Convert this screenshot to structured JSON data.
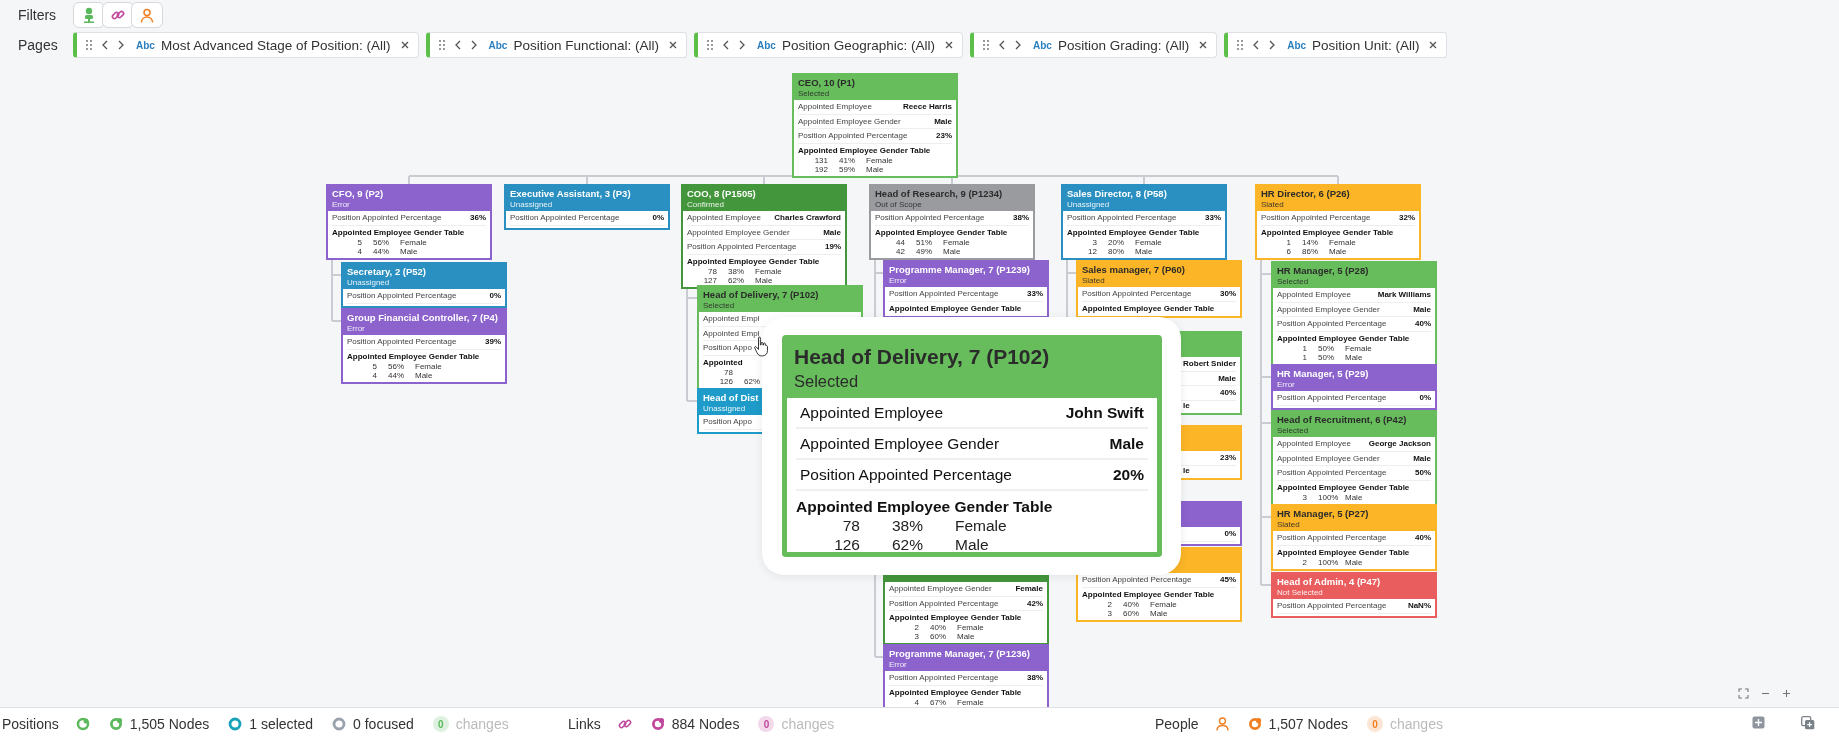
{
  "filters": {
    "label": "Filters",
    "chips": [
      {
        "kind": "position",
        "color": "#5cb85c"
      },
      {
        "kind": "link",
        "color": "#c0479b"
      },
      {
        "kind": "person",
        "color": "#f07f22"
      }
    ]
  },
  "pages": {
    "label": "Pages",
    "chips": [
      {
        "type_label": "Abc",
        "text": "Most Advanced Stage of Position: (All)"
      },
      {
        "type_label": "Abc",
        "text": "Position Functional: (All)"
      },
      {
        "type_label": "Abc",
        "text": "Position Geographic: (All)"
      },
      {
        "type_label": "Abc",
        "text": "Position Grading: (All)"
      },
      {
        "type_label": "Abc",
        "text": "Position Unit: (All)"
      }
    ]
  },
  "org": [
    {
      "title": "CEO, 10 (P1)",
      "status": "Selected",
      "color": "#67bd5c",
      "rows": [
        {
          "kind": "pair",
          "label": "Appointed Employee",
          "value": "Reece Harris"
        },
        {
          "kind": "pair",
          "label": "Appointed Employee Gender",
          "value": "Male"
        },
        {
          "kind": "pair",
          "label": "Position Appointed Percentage",
          "value": "23%"
        },
        {
          "kind": "heading",
          "text": "Appointed Employee Gender Table"
        },
        {
          "kind": "data",
          "cells": [
            "131",
            "41%",
            "Female"
          ]
        },
        {
          "kind": "data",
          "cells": [
            "192",
            "59%",
            "Male"
          ]
        }
      ],
      "children": [
        {
          "title": "CFO, 9 (P2)",
          "status": "Error",
          "color": "#8c62cc",
          "rows": [
            {
              "kind": "pair",
              "label": "Position Appointed Percentage",
              "value": "36%"
            },
            {
              "kind": "heading",
              "text": "Appointed Employee Gender Table"
            },
            {
              "kind": "data",
              "cells": [
                "5",
                "56%",
                "Female"
              ]
            },
            {
              "kind": "data",
              "cells": [
                "4",
                "44%",
                "Male"
              ]
            }
          ],
          "children": [
            {
              "title": "Secretary, 2 (P52)",
              "status": "Unassigned",
              "color": "#2a8fc1",
              "rows": [
                {
                  "kind": "pair",
                  "label": "Position Appointed Percentage",
                  "value": "0%"
                }
              ]
            },
            {
              "title": "Group Financial Controller, 7 (P4)",
              "status": "Error",
              "color": "#8c62cc",
              "rows": [
                {
                  "kind": "pair",
                  "label": "Position Appointed Percentage",
                  "value": "39%"
                },
                {
                  "kind": "heading",
                  "text": "Appointed Employee Gender Table"
                },
                {
                  "kind": "data",
                  "cells": [
                    "5",
                    "56%",
                    "Female"
                  ]
                },
                {
                  "kind": "data",
                  "cells": [
                    "4",
                    "44%",
                    "Male"
                  ]
                }
              ]
            }
          ]
        },
        {
          "title": "Executive Assistant, 3 (P3)",
          "status": "Unassigned",
          "color": "#2a8fc1",
          "rows": [
            {
              "kind": "pair",
              "label": "Position Appointed Percentage",
              "value": "0%"
            }
          ]
        },
        {
          "title": "COO, 8 (P1505)",
          "status": "Confirmed",
          "color": "#43963b",
          "rows": [
            {
              "kind": "pair",
              "label": "Appointed Employee",
              "value": "Charles Crawford"
            },
            {
              "kind": "pair",
              "label": "Appointed Employee Gender",
              "value": "Male"
            },
            {
              "kind": "pair",
              "label": "Position Appointed Percentage",
              "value": "19%"
            },
            {
              "kind": "heading",
              "text": "Appointed Employee Gender Table"
            },
            {
              "kind": "data",
              "cells": [
                "78",
                "38%",
                "Female"
              ]
            },
            {
              "kind": "data",
              "cells": [
                "127",
                "62%",
                "Male"
              ]
            }
          ],
          "children": [
            {
              "title": "Head of Delivery, 7 (P102)",
              "status": "Selected",
              "color": "#67bd5c",
              "rows": [
                {
                  "kind": "pair",
                  "label": "Appointed Empl"
                },
                {
                  "kind": "pair",
                  "label": "Appointed Empl"
                },
                {
                  "kind": "pair",
                  "label": "Position Appo"
                },
                {
                  "kind": "heading",
                  "text": "Appointed"
                },
                {
                  "kind": "data",
                  "cells": [
                    "78"
                  ]
                },
                {
                  "kind": "data",
                  "cells": [
                    "126",
                    "62%"
                  ]
                }
              ]
            },
            {
              "title": "Head of Dist",
              "status": "Unassigned",
              "color": "#1e9bc9",
              "rows": [
                {
                  "kind": "pair",
                  "label": "Position Appo"
                }
              ]
            }
          ]
        },
        {
          "title": "Head of Research, 9 (P1234)",
          "status": "Out of Scope",
          "color": "#9a9b9e",
          "rows": [
            {
              "kind": "pair",
              "label": "Position Appointed Percentage",
              "value": "38%"
            },
            {
              "kind": "heading",
              "text": "Appointed Employee Gender Table"
            },
            {
              "kind": "data",
              "cells": [
                "44",
                "51%",
                "Female"
              ]
            },
            {
              "kind": "data",
              "cells": [
                "42",
                "49%",
                "Male"
              ]
            }
          ],
          "children": [
            {
              "title": "Programme Manager, 7 (P1239)",
              "status": "Error",
              "color": "#8c62cc",
              "rows": [
                {
                  "kind": "pair",
                  "label": "Position Appointed Percentage",
                  "value": "33%"
                },
                {
                  "kind": "heading",
                  "text": "Appointed Employee Gender Table"
                }
              ]
            },
            {
              "color": "#43963b",
              "rows": [
                {
                  "kind": "pair",
                  "label": "Appointed Employee Gender",
                  "value": "Female"
                },
                {
                  "kind": "pair",
                  "label": "Position Appointed Percentage",
                  "value": "42%"
                },
                {
                  "kind": "heading",
                  "text": "Appointed Employee Gender Table"
                },
                {
                  "kind": "data",
                  "cells": [
                    "2",
                    "40%",
                    "Female"
                  ]
                },
                {
                  "kind": "data",
                  "cells": [
                    "3",
                    "60%",
                    "Male"
                  ]
                }
              ]
            },
            {
              "title": "Programme Manager, 7 (P1236)",
              "status": "Error",
              "color": "#8c62cc",
              "rows": [
                {
                  "kind": "pair",
                  "label": "Position Appointed Percentage",
                  "value": "38%"
                },
                {
                  "kind": "heading",
                  "text": "Appointed Employee Gender Table"
                },
                {
                  "kind": "data",
                  "cells": [
                    "4",
                    "67%",
                    "Female"
                  ]
                }
              ]
            }
          ]
        },
        {
          "title": "Sales Director, 8 (P58)",
          "status": "Unassigned",
          "color": "#2a8fc1",
          "rows": [
            {
              "kind": "pair",
              "label": "Position Appointed Percentage",
              "value": "33%"
            },
            {
              "kind": "heading",
              "text": "Appointed Employee Gender Table"
            },
            {
              "kind": "data",
              "cells": [
                "3",
                "20%",
                "Female"
              ]
            },
            {
              "kind": "data",
              "cells": [
                "12",
                "80%",
                "Male"
              ]
            }
          ],
          "children": [
            {
              "title": "Sales manager, 7 (P60)",
              "status": "Slated",
              "color": "#fbb526",
              "rows": [
                {
                  "kind": "pair",
                  "label": "Position Appointed Percentage",
                  "value": "30%"
                },
                {
                  "kind": "heading",
                  "text": "Appointed Employee Gender Table"
                }
              ]
            },
            {
              "color": "#67bd5c",
              "rows": [
                {
                  "kind": "pair",
                  "value": "Robert Snider"
                },
                {
                  "kind": "pair",
                  "value": "Male"
                },
                {
                  "kind": "pair",
                  "value": "40%"
                },
                {
                  "kind": "tail",
                  "text": "le"
                }
              ]
            },
            {
              "color": "#fbb526",
              "rows": [
                {
                  "kind": "pair",
                  "value": "23%"
                },
                {
                  "kind": "tail",
                  "text": "le"
                }
              ]
            },
            {
              "color": "#8c62cc",
              "rows": [
                {
                  "kind": "pair",
                  "value": "0%"
                }
              ]
            },
            {
              "color": "#fbb526",
              "rows": [
                {
                  "kind": "pair",
                  "label": "Position Appointed Percentage",
                  "value": "45%"
                },
                {
                  "kind": "heading",
                  "text": "Appointed Employee Gender Table"
                },
                {
                  "kind": "data",
                  "cells": [
                    "2",
                    "40%",
                    "Female"
                  ]
                },
                {
                  "kind": "data",
                  "cells": [
                    "3",
                    "60%",
                    "Male"
                  ]
                }
              ]
            }
          ]
        },
        {
          "title": "HR Director, 6 (P26)",
          "status": "Slated",
          "color": "#fbb526",
          "rows": [
            {
              "kind": "pair",
              "label": "Position Appointed Percentage",
              "value": "32%"
            },
            {
              "kind": "heading",
              "text": "Appointed Employee Gender Table"
            },
            {
              "kind": "data",
              "cells": [
                "1",
                "14%",
                "Female"
              ]
            },
            {
              "kind": "data",
              "cells": [
                "6",
                "86%",
                "Male"
              ]
            }
          ],
          "children": [
            {
              "title": "HR Manager, 5 (P28)",
              "status": "Selected",
              "color": "#67bd5c",
              "rows": [
                {
                  "kind": "pair",
                  "label": "Appointed Employee",
                  "value": "Mark Williams"
                },
                {
                  "kind": "pair",
                  "label": "Appointed Employee Gender",
                  "value": "Male"
                },
                {
                  "kind": "pair",
                  "label": "Position Appointed Percentage",
                  "value": "40%"
                },
                {
                  "kind": "heading",
                  "text": "Appointed Employee Gender Table"
                },
                {
                  "kind": "data",
                  "cells": [
                    "1",
                    "50%",
                    "Female"
                  ]
                },
                {
                  "kind": "data",
                  "cells": [
                    "1",
                    "50%",
                    "Male"
                  ]
                }
              ]
            },
            {
              "title": "HR Manager, 5 (P29)",
              "status": "Error",
              "color": "#8c62cc",
              "rows": [
                {
                  "kind": "pair",
                  "label": "Position Appointed Percentage",
                  "value": "0%"
                }
              ]
            },
            {
              "title": "Head of Recruitment, 6 (P42)",
              "status": "Selected",
              "color": "#67bd5c",
              "rows": [
                {
                  "kind": "pair",
                  "label": "Appointed Employee",
                  "value": "George Jackson"
                },
                {
                  "kind": "pair",
                  "label": "Appointed Employee Gender",
                  "value": "Male"
                },
                {
                  "kind": "pair",
                  "label": "Position Appointed Percentage",
                  "value": "50%"
                },
                {
                  "kind": "heading",
                  "text": "Appointed Employee Gender Table"
                },
                {
                  "kind": "data",
                  "cells": [
                    "3",
                    "100%",
                    "Male"
                  ]
                }
              ]
            },
            {
              "title": "HR Manager, 5 (P27)",
              "status": "Slated",
              "color": "#fbb526",
              "rows": [
                {
                  "kind": "pair",
                  "label": "Position Appointed Percentage",
                  "value": "40%"
                },
                {
                  "kind": "heading",
                  "text": "Appointed Employee Gender Table"
                },
                {
                  "kind": "data",
                  "cells": [
                    "2",
                    "100%",
                    "Male"
                  ]
                }
              ]
            },
            {
              "title": "Head of Admin, 4 (P47)",
              "status": "Not Selected",
              "color": "#e95d5f",
              "rows": [
                {
                  "kind": "pair",
                  "label": "Position Appointed Percentage",
                  "value": "NaN%"
                }
              ]
            }
          ]
        }
      ]
    }
  ],
  "popup": {
    "title": "Head of Delivery, 7 (P102)",
    "status": "Selected",
    "color": "#67bd5c",
    "rows": [
      {
        "kind": "pair",
        "label": "Appointed Employee",
        "value": "John Swift"
      },
      {
        "kind": "pair",
        "label": "Appointed Employee Gender",
        "value": "Male"
      },
      {
        "kind": "pair",
        "label": "Position Appointed Percentage",
        "value": "20%"
      },
      {
        "kind": "heading",
        "text": "Appointed Employee Gender Table"
      },
      {
        "kind": "data",
        "cells": [
          "78",
          "38%",
          "Female"
        ]
      },
      {
        "kind": "data",
        "cells": [
          "126",
          "62%",
          "Male"
        ]
      }
    ]
  },
  "status_bar": {
    "groups": [
      {
        "kind": "position",
        "label": "Positions",
        "color": "#5cb85c",
        "stats": [
          {
            "kind": "nodes",
            "text": "1,505 Nodes"
          },
          {
            "kind": "selected",
            "text": "1 selected"
          },
          {
            "kind": "focused",
            "text": "0 focused"
          },
          {
            "kind": "changes",
            "count": "0",
            "text": "changes"
          }
        ]
      },
      {
        "kind": "link",
        "label": "Links",
        "color": "#c0479b",
        "stats": [
          {
            "kind": "nodes",
            "text": "884 Nodes"
          },
          {
            "kind": "changes",
            "count": "0",
            "text": "changes"
          }
        ]
      },
      {
        "kind": "person",
        "label": "People",
        "color": "#f07f22",
        "stats": [
          {
            "kind": "nodes",
            "text": "1,507 Nodes"
          },
          {
            "kind": "changes",
            "count": "0",
            "text": "changes"
          }
        ]
      }
    ]
  }
}
